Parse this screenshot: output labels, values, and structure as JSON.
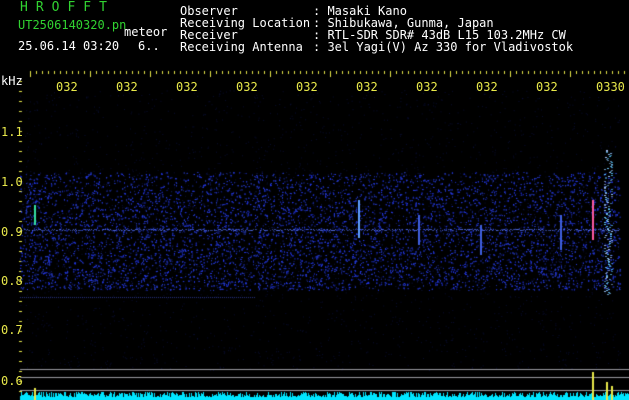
{
  "header": {
    "brand": "HROFFT",
    "file_name": "UT2506140320.pn",
    "file_type": "meteor",
    "date_time": "25.06.14 03:20",
    "info": "6.."
  },
  "station": {
    "observer_label": "Observer",
    "observer_value": ": Masaki Kano",
    "location_label": "Receiving Location",
    "location_value": ": Shibukawa, Gunma, Japan",
    "receiver_label": "Receiver",
    "receiver_value": ": RTL-SDR SDR# 43dB L15 103.2MHz CW",
    "antenna_label": "Receiving Antenna",
    "antenna_value": ": 3el Yagi(V) Az 330 for Vladivostok"
  },
  "axis": {
    "unit": "kHz",
    "time_labels": [
      "032",
      "032",
      "032",
      "032",
      "032",
      "032",
      "032",
      "032",
      "032",
      "0330"
    ],
    "freq_labels": [
      "1.1",
      "1.0",
      "0.9",
      "0.8",
      "0.7",
      "0.6"
    ]
  },
  "colors": {
    "background": "#000000",
    "text_green": "#31d231",
    "text_yellow": "#e8e84a",
    "noise": "#2a3bd0",
    "spectrum": "#00e5ff"
  }
}
